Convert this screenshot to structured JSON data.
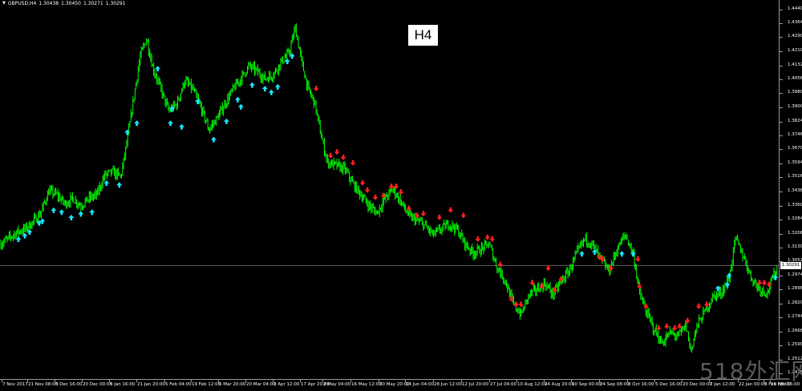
{
  "header": {
    "symbol": "GBPUSD,H4",
    "open": "1.30438",
    "high": "1.30450",
    "low": "1.30271",
    "close": "1.30291"
  },
  "timeframe_label": "H4",
  "price_axis": {
    "labels": [
      "1.44400",
      "1.43640",
      "1.42900",
      "1.42100",
      "1.41320",
      "1.40560",
      "1.39800",
      "1.39000",
      "1.38240",
      "1.37460",
      "1.36700",
      "1.35940",
      "1.35160",
      "1.34380",
      "1.33600",
      "1.32840",
      "1.32060",
      "1.31300",
      "1.30520",
      "1.29740",
      "1.28980",
      "1.28200",
      "1.27440",
      "1.26660",
      "1.25900",
      "1.25120",
      "1.24360"
    ],
    "current_price": "1.30291"
  },
  "time_axis": {
    "labels": [
      "7 Nov 2017",
      "21 Nov 08:00",
      "5 Dec 16:00",
      "20 Dec 00:00",
      "5 Jan 16:00",
      "21 Jan 20:00",
      "5 Feb 04:00",
      "19 Feb 12:00",
      "5 Mar 20:00",
      "20 Mar 04:00",
      "3 Apr 12:00",
      "17 Apr 20:00",
      "2 May 04:00",
      "16 May 12:00",
      "30 May 20:00",
      "14 Jun 04:00",
      "28 Jun 12:00",
      "12 Jul 20:00",
      "27 Jul 04:00",
      "10 Aug 12:00",
      "24 Aug 20:00",
      "10 Sep 00:00",
      "24 Sep 08:00",
      "8 Oct 16:00",
      "5 Dec 16:00",
      "20 Dec 00:00",
      "7 Jan 12:00",
      "22 Jan 00:00",
      "5 Feb 08:00",
      "19 Feb 16:00"
    ]
  },
  "colors": {
    "background": "#000000",
    "candles": "#00ff00",
    "buy_arrow": "#19e6ff",
    "sell_arrow": "#ff2020",
    "grid": "#9a9a9a"
  },
  "watermark": "518外汇网",
  "chart_data": {
    "type": "line",
    "title": "",
    "xlabel": "",
    "ylabel": "",
    "ylim": [
      1.2436,
      1.444
    ],
    "points": [
      {
        "t": 0,
        "p": 1.315
      },
      {
        "t": 10,
        "p": 1.318
      },
      {
        "t": 20,
        "p": 1.3215
      },
      {
        "t": 30,
        "p": 1.323
      },
      {
        "t": 40,
        "p": 1.327
      },
      {
        "t": 50,
        "p": 1.332
      },
      {
        "t": 60,
        "p": 1.344
      },
      {
        "t": 70,
        "p": 1.342
      },
      {
        "t": 80,
        "p": 1.337
      },
      {
        "t": 90,
        "p": 1.34
      },
      {
        "t": 100,
        "p": 1.336
      },
      {
        "t": 110,
        "p": 1.34
      },
      {
        "t": 120,
        "p": 1.342
      },
      {
        "t": 130,
        "p": 1.353
      },
      {
        "t": 140,
        "p": 1.3545
      },
      {
        "t": 150,
        "p": 1.352
      },
      {
        "t": 158,
        "p": 1.372
      },
      {
        "t": 166,
        "p": 1.395
      },
      {
        "t": 174,
        "p": 1.418
      },
      {
        "t": 182,
        "p": 1.428
      },
      {
        "t": 190,
        "p": 1.412
      },
      {
        "t": 200,
        "p": 1.4
      },
      {
        "t": 210,
        "p": 1.388
      },
      {
        "t": 220,
        "p": 1.392
      },
      {
        "t": 230,
        "p": 1.405
      },
      {
        "t": 240,
        "p": 1.4
      },
      {
        "t": 250,
        "p": 1.39
      },
      {
        "t": 260,
        "p": 1.378
      },
      {
        "t": 270,
        "p": 1.384
      },
      {
        "t": 280,
        "p": 1.392
      },
      {
        "t": 290,
        "p": 1.4
      },
      {
        "t": 300,
        "p": 1.406
      },
      {
        "t": 310,
        "p": 1.413
      },
      {
        "t": 320,
        "p": 1.41
      },
      {
        "t": 330,
        "p": 1.406
      },
      {
        "t": 340,
        "p": 1.408
      },
      {
        "t": 350,
        "p": 1.415
      },
      {
        "t": 360,
        "p": 1.42
      },
      {
        "t": 368,
        "p": 1.434
      },
      {
        "t": 376,
        "p": 1.415
      },
      {
        "t": 384,
        "p": 1.4
      },
      {
        "t": 392,
        "p": 1.393
      },
      {
        "t": 400,
        "p": 1.375
      },
      {
        "t": 408,
        "p": 1.36
      },
      {
        "t": 420,
        "p": 1.358
      },
      {
        "t": 430,
        "p": 1.356
      },
      {
        "t": 440,
        "p": 1.348
      },
      {
        "t": 450,
        "p": 1.342
      },
      {
        "t": 460,
        "p": 1.336
      },
      {
        "t": 470,
        "p": 1.332
      },
      {
        "t": 480,
        "p": 1.34
      },
      {
        "t": 490,
        "p": 1.345
      },
      {
        "t": 500,
        "p": 1.338
      },
      {
        "t": 510,
        "p": 1.33
      },
      {
        "t": 520,
        "p": 1.328
      },
      {
        "t": 530,
        "p": 1.325
      },
      {
        "t": 540,
        "p": 1.32
      },
      {
        "t": 550,
        "p": 1.323
      },
      {
        "t": 560,
        "p": 1.326
      },
      {
        "t": 570,
        "p": 1.323
      },
      {
        "t": 580,
        "p": 1.315
      },
      {
        "t": 590,
        "p": 1.31
      },
      {
        "t": 600,
        "p": 1.312
      },
      {
        "t": 610,
        "p": 1.315
      },
      {
        "t": 620,
        "p": 1.302
      },
      {
        "t": 630,
        "p": 1.295
      },
      {
        "t": 640,
        "p": 1.282
      },
      {
        "t": 650,
        "p": 1.276
      },
      {
        "t": 660,
        "p": 1.287
      },
      {
        "t": 670,
        "p": 1.29
      },
      {
        "t": 680,
        "p": 1.293
      },
      {
        "t": 690,
        "p": 1.287
      },
      {
        "t": 700,
        "p": 1.294
      },
      {
        "t": 710,
        "p": 1.3
      },
      {
        "t": 720,
        "p": 1.31
      },
      {
        "t": 730,
        "p": 1.318
      },
      {
        "t": 740,
        "p": 1.314
      },
      {
        "t": 750,
        "p": 1.306
      },
      {
        "t": 760,
        "p": 1.3
      },
      {
        "t": 770,
        "p": 1.312
      },
      {
        "t": 780,
        "p": 1.32
      },
      {
        "t": 790,
        "p": 1.31
      },
      {
        "t": 798,
        "p": 1.288
      },
      {
        "t": 806,
        "p": 1.278
      },
      {
        "t": 816,
        "p": 1.268
      },
      {
        "t": 826,
        "p": 1.26
      },
      {
        "t": 836,
        "p": 1.266
      },
      {
        "t": 846,
        "p": 1.264
      },
      {
        "t": 856,
        "p": 1.27
      },
      {
        "t": 862,
        "p": 1.256
      },
      {
        "t": 870,
        "p": 1.27
      },
      {
        "t": 880,
        "p": 1.278
      },
      {
        "t": 890,
        "p": 1.286
      },
      {
        "t": 900,
        "p": 1.288
      },
      {
        "t": 910,
        "p": 1.296
      },
      {
        "t": 918,
        "p": 1.318
      },
      {
        "t": 928,
        "p": 1.308
      },
      {
        "t": 938,
        "p": 1.296
      },
      {
        "t": 948,
        "p": 1.29
      },
      {
        "t": 958,
        "p": 1.288
      },
      {
        "t": 966,
        "p": 1.298
      },
      {
        "t": 971,
        "p": 1.3029
      }
    ],
    "buy_signals": [
      {
        "t": 22,
        "p": 1.319
      },
      {
        "t": 30,
        "p": 1.321
      },
      {
        "t": 36,
        "p": 1.323
      },
      {
        "t": 48,
        "p": 1.328
      },
      {
        "t": 52,
        "p": 1.329
      },
      {
        "t": 66,
        "p": 1.335
      },
      {
        "t": 76,
        "p": 1.334
      },
      {
        "t": 88,
        "p": 1.331
      },
      {
        "t": 100,
        "p": 1.333
      },
      {
        "t": 114,
        "p": 1.334
      },
      {
        "t": 132,
        "p": 1.35
      },
      {
        "t": 148,
        "p": 1.349
      },
      {
        "t": 158,
        "p": 1.378
      },
      {
        "t": 170,
        "p": 1.383
      },
      {
        "t": 196,
        "p": 1.413
      },
      {
        "t": 214,
        "p": 1.391
      },
      {
        "t": 212,
        "p": 1.383
      },
      {
        "t": 226,
        "p": 1.381
      },
      {
        "t": 246,
        "p": 1.395
      },
      {
        "t": 266,
        "p": 1.374
      },
      {
        "t": 282,
        "p": 1.384
      },
      {
        "t": 296,
        "p": 1.396
      },
      {
        "t": 300,
        "p": 1.392
      },
      {
        "t": 314,
        "p": 1.404
      },
      {
        "t": 330,
        "p": 1.402
      },
      {
        "t": 338,
        "p": 1.4
      },
      {
        "t": 346,
        "p": 1.403
      },
      {
        "t": 358,
        "p": 1.417
      },
      {
        "t": 364,
        "p": 1.42
      },
      {
        "t": 726,
        "p": 1.311
      },
      {
        "t": 742,
        "p": 1.312
      },
      {
        "t": 776,
        "p": 1.311
      },
      {
        "t": 790,
        "p": 1.311
      },
      {
        "t": 896,
        "p": 1.292
      },
      {
        "t": 908,
        "p": 1.294
      },
      {
        "t": 910,
        "p": 1.299
      },
      {
        "t": 968,
        "p": 1.298
      }
    ],
    "sell_signals": [
      {
        "t": 394,
        "p": 1.399
      },
      {
        "t": 412,
        "p": 1.362
      },
      {
        "t": 420,
        "p": 1.364
      },
      {
        "t": 428,
        "p": 1.361
      },
      {
        "t": 440,
        "p": 1.358
      },
      {
        "t": 452,
        "p": 1.347
      },
      {
        "t": 458,
        "p": 1.343
      },
      {
        "t": 468,
        "p": 1.339
      },
      {
        "t": 478,
        "p": 1.34
      },
      {
        "t": 488,
        "p": 1.345
      },
      {
        "t": 494,
        "p": 1.345
      },
      {
        "t": 500,
        "p": 1.342
      },
      {
        "t": 510,
        "p": 1.333
      },
      {
        "t": 520,
        "p": 1.329
      },
      {
        "t": 528,
        "p": 1.33
      },
      {
        "t": 548,
        "p": 1.328
      },
      {
        "t": 562,
        "p": 1.332
      },
      {
        "t": 578,
        "p": 1.329
      },
      {
        "t": 596,
        "p": 1.316
      },
      {
        "t": 608,
        "p": 1.317
      },
      {
        "t": 614,
        "p": 1.316
      },
      {
        "t": 624,
        "p": 1.302
      },
      {
        "t": 638,
        "p": 1.283
      },
      {
        "t": 644,
        "p": 1.28
      },
      {
        "t": 650,
        "p": 1.28
      },
      {
        "t": 664,
        "p": 1.292
      },
      {
        "t": 676,
        "p": 1.29
      },
      {
        "t": 684,
        "p": 1.3
      },
      {
        "t": 692,
        "p": 1.288
      },
      {
        "t": 700,
        "p": 1.294
      },
      {
        "t": 748,
        "p": 1.306
      },
      {
        "t": 752,
        "p": 1.305
      },
      {
        "t": 762,
        "p": 1.3
      },
      {
        "t": 796,
        "p": 1.305
      },
      {
        "t": 798,
        "p": 1.29
      },
      {
        "t": 806,
        "p": 1.279
      },
      {
        "t": 822,
        "p": 1.267
      },
      {
        "t": 832,
        "p": 1.268
      },
      {
        "t": 842,
        "p": 1.267
      },
      {
        "t": 848,
        "p": 1.268
      },
      {
        "t": 858,
        "p": 1.271
      },
      {
        "t": 872,
        "p": 1.279
      },
      {
        "t": 882,
        "p": 1.28
      },
      {
        "t": 948,
        "p": 1.292
      },
      {
        "t": 954,
        "p": 1.292
      },
      {
        "t": 960,
        "p": 1.291
      }
    ]
  }
}
